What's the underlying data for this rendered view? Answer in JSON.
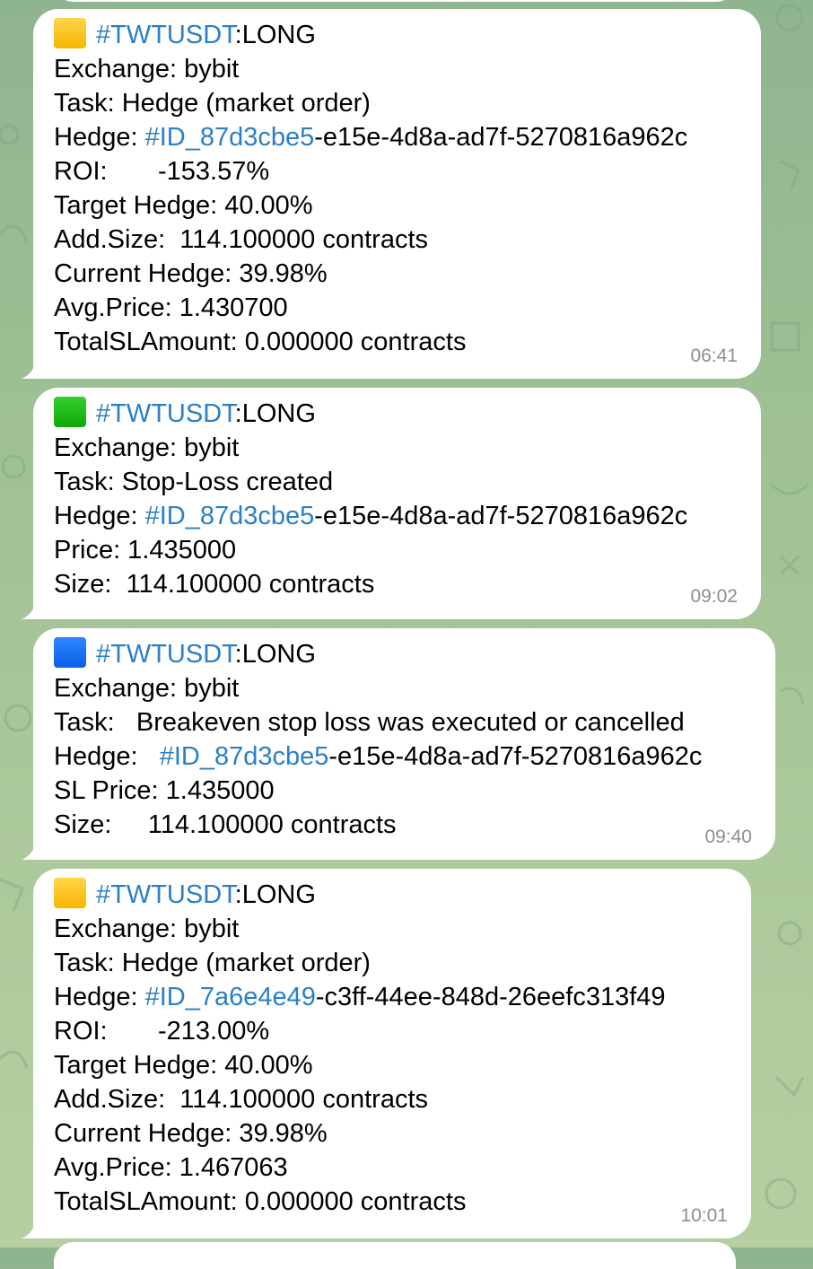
{
  "messages": [
    {
      "status_color": "yellow",
      "hashtag": "#TWTUSDT",
      "direction": ":LONG",
      "lines": [
        {
          "text": "Exchange: bybit"
        },
        {
          "text": "Task: Hedge (market order)"
        },
        {
          "label": "Hedge: ",
          "link": "#ID_87d3cbe5",
          "suffix": "-e15e-4d8a-ad7f-5270816a962c"
        },
        {
          "text": "ROI:       -153.57%"
        },
        {
          "text": "Target Hedge: 40.00%"
        },
        {
          "text": "Add.Size:  114.100000 contracts"
        },
        {
          "text": "Current Hedge: 39.98%"
        },
        {
          "text": "Avg.Price: 1.430700"
        },
        {
          "text": "TotalSLAmount: 0.000000 contracts"
        }
      ],
      "time": "06:41"
    },
    {
      "status_color": "green",
      "hashtag": "#TWTUSDT",
      "direction": ":LONG",
      "lines": [
        {
          "text": "Exchange: bybit"
        },
        {
          "text": "Task: Stop-Loss created"
        },
        {
          "label": "Hedge: ",
          "link": "#ID_87d3cbe5",
          "suffix": "-e15e-4d8a-ad7f-5270816a962c"
        },
        {
          "text": "Price: 1.435000"
        },
        {
          "text": "Size:  114.100000 contracts"
        }
      ],
      "time": "09:02"
    },
    {
      "status_color": "blue",
      "hashtag": "#TWTUSDT",
      "direction": ":LONG",
      "lines": [
        {
          "text": "Exchange: bybit"
        },
        {
          "text": "Task:   Breakeven stop loss was executed or cancelled"
        },
        {
          "label": "Hedge:   ",
          "link": "#ID_87d3cbe5",
          "suffix": "-e15e-4d8a-ad7f-5270816a962c"
        },
        {
          "text": "SL Price: 1.435000"
        },
        {
          "text": "Size:     114.100000 contracts"
        }
      ],
      "time": "09:40"
    },
    {
      "status_color": "yellow",
      "hashtag": "#TWTUSDT",
      "direction": ":LONG",
      "lines": [
        {
          "text": "Exchange: bybit"
        },
        {
          "text": "Task: Hedge (market order)"
        },
        {
          "label": "Hedge: ",
          "link": "#ID_7a6e4e49",
          "suffix": "-c3ff-44ee-848d-26eefc313f49"
        },
        {
          "text": "ROI:       -213.00%"
        },
        {
          "text": "Target Hedge: 40.00%"
        },
        {
          "text": "Add.Size:  114.100000 contracts"
        },
        {
          "text": "Current Hedge: 39.98%"
        },
        {
          "text": "Avg.Price: 1.467063"
        },
        {
          "text": "TotalSLAmount: 0.000000 contracts"
        }
      ],
      "time": "10:01"
    }
  ]
}
